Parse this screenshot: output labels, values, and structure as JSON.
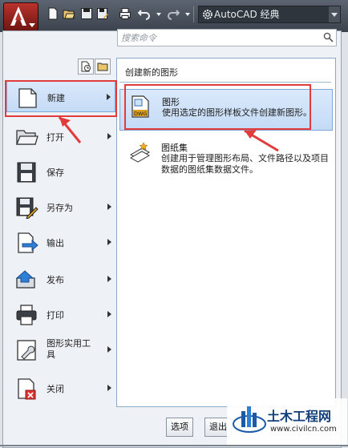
{
  "titlebar": {
    "workspace": "AutoCAD 经典",
    "quick_access_icons": [
      "new-icon",
      "open-icon",
      "save-icon",
      "save-as-icon",
      "print-icon",
      "undo-icon",
      "redo-icon"
    ]
  },
  "search": {
    "placeholder": "搜索命令"
  },
  "left_menu": {
    "items": [
      {
        "label": "新建",
        "icon": "new-document-icon",
        "has_submenu": true,
        "selected": true
      },
      {
        "label": "打开",
        "icon": "open-folder-icon",
        "has_submenu": true
      },
      {
        "label": "保存",
        "icon": "save-disk-icon",
        "has_submenu": false
      },
      {
        "label": "另存为",
        "icon": "save-as-icon",
        "has_submenu": true
      },
      {
        "label": "输出",
        "icon": "export-icon",
        "has_submenu": true
      },
      {
        "label": "发布",
        "icon": "publish-icon",
        "has_submenu": true
      },
      {
        "label": "打印",
        "icon": "printer-icon",
        "has_submenu": true
      },
      {
        "label": "图形实用工具",
        "icon": "drawing-utilities-icon",
        "has_submenu": true
      },
      {
        "label": "关闭",
        "icon": "close-document-icon",
        "has_submenu": true
      }
    ]
  },
  "right_pane": {
    "title": "创建新的图形",
    "items": [
      {
        "title": "图形",
        "desc": "使用选定的图形样板文件创建新图形。",
        "icon": "dwg-drawing-icon",
        "selected": true
      },
      {
        "title": "图纸集",
        "desc": "创建用于管理图形布局、文件路径以及项目数据的图纸集数据文件。",
        "icon": "sheet-set-icon"
      }
    ]
  },
  "footer": {
    "options_label": "选项",
    "exit_label": "退出"
  },
  "watermark": {
    "title": "土木工程网",
    "url": "www.civilcn.com"
  },
  "colors": {
    "highlight": "#e23b3b",
    "selection": "#c4dbf6",
    "titlebar": "#3b424c"
  }
}
